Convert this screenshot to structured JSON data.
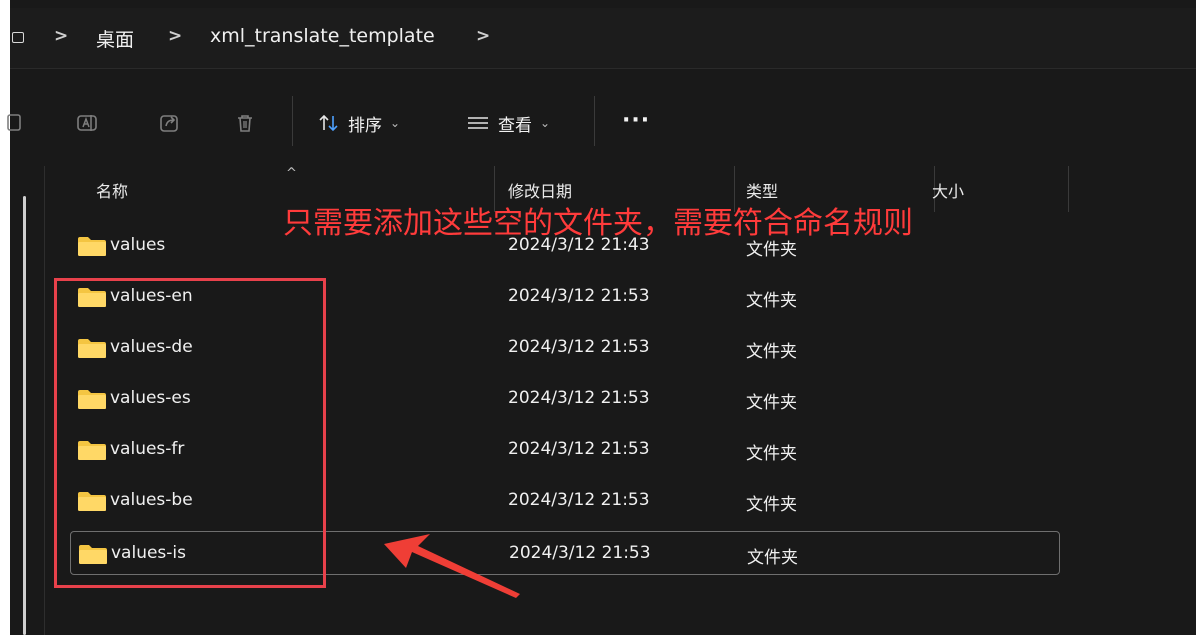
{
  "breadcrumb": {
    "separator": ">",
    "items": [
      "桌面",
      "xml_translate_template"
    ]
  },
  "toolbar": {
    "sort_label": "排序",
    "view_label": "查看",
    "more_label": "···"
  },
  "columns": {
    "name": "名称",
    "date": "修改日期",
    "type": "类型",
    "size": "大小"
  },
  "files": [
    {
      "name": "values",
      "date": "2024/3/12 21:43",
      "type": "文件夹"
    },
    {
      "name": "values-en",
      "date": "2024/3/12 21:53",
      "type": "文件夹"
    },
    {
      "name": "values-de",
      "date": "2024/3/12 21:53",
      "type": "文件夹"
    },
    {
      "name": "values-es",
      "date": "2024/3/12 21:53",
      "type": "文件夹"
    },
    {
      "name": "values-fr",
      "date": "2024/3/12 21:53",
      "type": "文件夹"
    },
    {
      "name": "values-be",
      "date": "2024/3/12 21:53",
      "type": "文件夹"
    },
    {
      "name": "values-is",
      "date": "2024/3/12 21:53",
      "type": "文件夹"
    }
  ],
  "annotation": {
    "text": "只需要添加这些空的文件夹，需要符合命名规则",
    "color": "#ff3b3b"
  },
  "colors": {
    "background": "#191919",
    "folder": "#f4c542",
    "annotation_box": "#e8414b"
  }
}
